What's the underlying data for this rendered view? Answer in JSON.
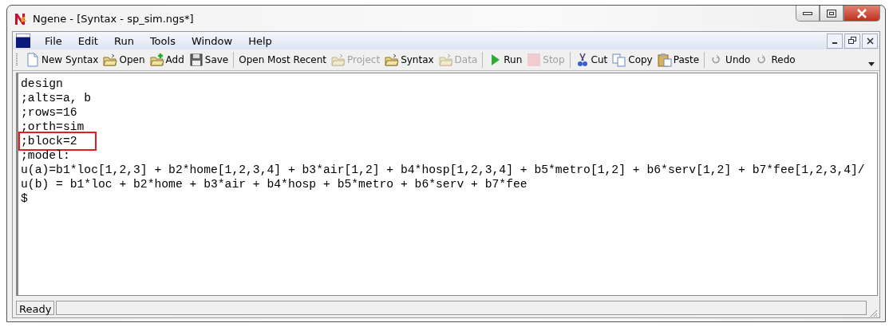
{
  "window": {
    "title": "Ngene - [Syntax - sp_sim.ngs*]"
  },
  "menu": [
    "File",
    "Edit",
    "Run",
    "Tools",
    "Window",
    "Help"
  ],
  "toolbar": [
    {
      "kind": "button",
      "label": "New Syntax",
      "disabled": false
    },
    {
      "kind": "button",
      "label": "Open",
      "disabled": false
    },
    {
      "kind": "button",
      "label": "Add",
      "disabled": false
    },
    {
      "kind": "button",
      "label": "Save",
      "disabled": false
    },
    {
      "kind": "separator"
    },
    {
      "kind": "button",
      "label": "Open Most Recent",
      "disabled": false
    },
    {
      "kind": "button",
      "label": "Project",
      "disabled": true
    },
    {
      "kind": "button",
      "label": "Syntax",
      "disabled": false
    },
    {
      "kind": "button",
      "label": "Data",
      "disabled": true
    },
    {
      "kind": "separator"
    },
    {
      "kind": "button",
      "label": "Run",
      "disabled": false
    },
    {
      "kind": "button",
      "label": "Stop",
      "disabled": true
    },
    {
      "kind": "separator"
    },
    {
      "kind": "button",
      "label": "Cut",
      "disabled": false
    },
    {
      "kind": "button",
      "label": "Copy",
      "disabled": false
    },
    {
      "kind": "button",
      "label": "Paste",
      "disabled": false
    },
    {
      "kind": "separator"
    },
    {
      "kind": "button",
      "label": "Undo",
      "disabled": false
    },
    {
      "kind": "button",
      "label": "Redo",
      "disabled": false
    }
  ],
  "editor": {
    "lines": [
      {
        "text": "design",
        "highlighted": false
      },
      {
        "text": ";alts=a, b",
        "highlighted": false
      },
      {
        "text": ";rows=16",
        "highlighted": false
      },
      {
        "text": ";orth=sim",
        "highlighted": false
      },
      {
        "text": ";block=2",
        "highlighted": true
      },
      {
        "text": ";model:",
        "highlighted": false
      },
      {
        "text": "u(a)=b1*loc[1,2,3] + b2*home[1,2,3,4] + b3*air[1,2] + b4*hosp[1,2,3,4] + b5*metro[1,2] + b6*serv[1,2] + b7*fee[1,2,3,4]/",
        "highlighted": false
      },
      {
        "text": "u(b) = b1*loc + b2*home + b3*air + b4*hosp + b5*metro + b6*serv + b7*fee",
        "highlighted": false
      },
      {
        "text": "$",
        "highlighted": false
      }
    ]
  },
  "status_bar": {
    "text": "Ready"
  }
}
